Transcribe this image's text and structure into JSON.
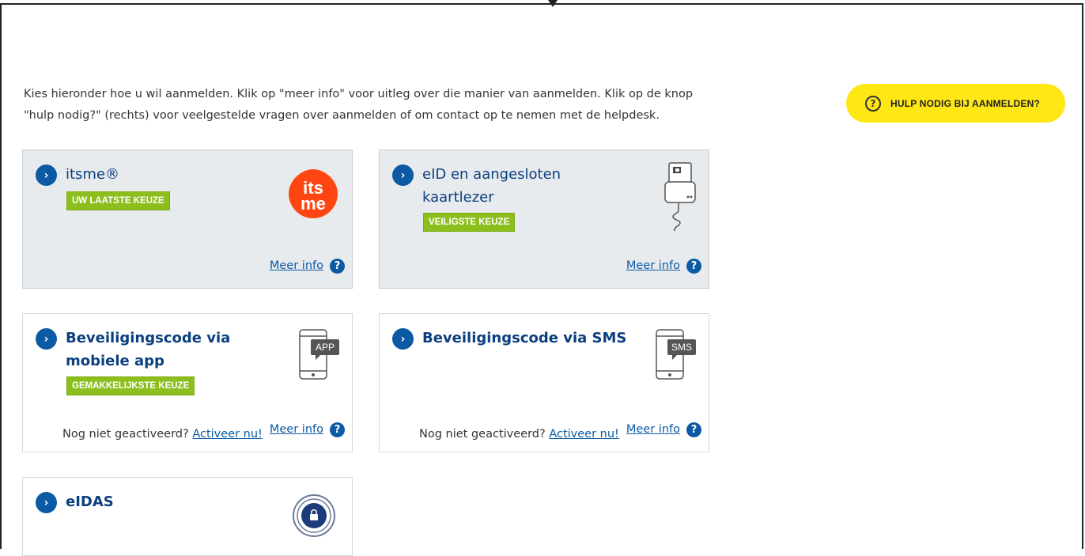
{
  "intro_text": "Kies hieronder hoe u wil aanmelden. Klik op \"meer info\" voor uitleg over die manier van aanmelden. Klik op de knop \"hulp nodig?\" (rechts) voor veelgestelde vragen over aanmelden of om contact op te nemen met de helpdesk.",
  "help_button": {
    "icon": "?",
    "label": "HULP NODIG BIJ AANMELDEN?"
  },
  "cards": [
    {
      "title": "itsme®",
      "badge": "UW LAATSTE KEUZE",
      "meer_info": "Meer info",
      "info_icon": "?",
      "chevron": "›",
      "logo_text_top": "its",
      "logo_text_bottom": "me"
    },
    {
      "title": "eID en aangesloten kaartlezer",
      "badge": "VEILIGSTE KEUZE",
      "meer_info": "Meer info",
      "info_icon": "?",
      "chevron": "›"
    },
    {
      "title": "Beveiligingscode via mobiele app",
      "badge": "GEMAKKELIJKSTE KEUZE",
      "meer_info": "Meer info",
      "info_icon": "?",
      "chevron": "›",
      "not_active": "Nog niet geactiveerd?",
      "activate": "Activeer nu!",
      "screen_label": "APP"
    },
    {
      "title": "Beveiligingscode via SMS",
      "meer_info": "Meer info",
      "info_icon": "?",
      "chevron": "›",
      "not_active": "Nog niet geactiveerd?",
      "activate": "Activeer nu!",
      "screen_label": "SMS"
    },
    {
      "title": "eIDAS",
      "chevron": "›"
    }
  ],
  "colors": {
    "primary_blue": "#0b5aa3",
    "badge_green": "#8cbf1e",
    "help_yellow": "#ffe615",
    "itsme_orange": "#ff4612"
  }
}
